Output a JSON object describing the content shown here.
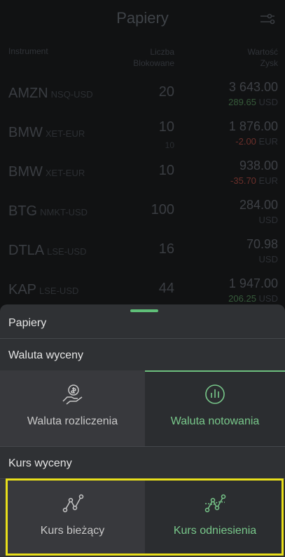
{
  "header": {
    "title": "Papiery"
  },
  "columns": {
    "instrument": "Instrument",
    "qty": "Liczba",
    "blocked": "Blokowane",
    "value": "Wartość",
    "profit": "Zysk"
  },
  "rows": [
    {
      "symbol": "AMZN",
      "market": "NSQ-USD",
      "qty": "20",
      "blocked": "",
      "value": "3 643.00",
      "change": "289.65",
      "currency": "USD",
      "change_sign": "pos"
    },
    {
      "symbol": "BMW",
      "market": "XET-EUR",
      "qty": "10",
      "blocked": "10",
      "value": "1 876.00",
      "change": "-2.00",
      "currency": "EUR",
      "change_sign": "neg"
    },
    {
      "symbol": "BMW",
      "market": "XET-EUR",
      "qty": "10",
      "blocked": "",
      "value": "938.00",
      "change": "-35.70",
      "currency": "EUR",
      "change_sign": "neg"
    },
    {
      "symbol": "BTG",
      "market": "NMKT-USD",
      "qty": "100",
      "blocked": "",
      "value": "284.00",
      "change": "",
      "currency": "USD",
      "change_sign": "none"
    },
    {
      "symbol": "DTLA",
      "market": "LSE-USD",
      "qty": "16",
      "blocked": "",
      "value": "70.98",
      "change": "",
      "currency": "USD",
      "change_sign": "none"
    },
    {
      "symbol": "KAP",
      "market": "LSE-USD",
      "qty": "44",
      "blocked": "",
      "value": "1 947.00",
      "change": "206.25",
      "currency": "USD",
      "change_sign": "pos"
    }
  ],
  "sheet": {
    "title": "Papiery",
    "valuation_currency_label": "Waluta wyceny",
    "currency_options": [
      {
        "label": "Waluta rozliczenia",
        "icon": "money-hand-icon",
        "selected": false
      },
      {
        "label": "Waluta notowania",
        "icon": "chart-circle-icon",
        "selected": true
      }
    ],
    "valuation_rate_label": "Kurs wyceny",
    "rate_options": [
      {
        "label": "Kurs bieżący",
        "icon": "line-chart-icon",
        "selected": false
      },
      {
        "label": "Kurs odniesienia",
        "icon": "line-chart-reference-icon",
        "selected": true
      }
    ]
  },
  "colors": {
    "accent": "#6dbf7e",
    "highlight": "#e8df1b"
  }
}
